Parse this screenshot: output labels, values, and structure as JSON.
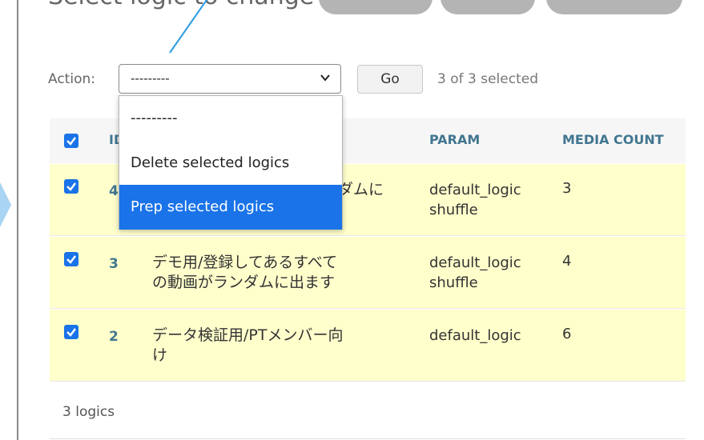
{
  "page": {
    "title": "Select logic to change"
  },
  "actions": {
    "label": "Action:",
    "selected_value": "---------",
    "go_label": "Go",
    "selection_count": "3 of 3 selected",
    "options": [
      "---------",
      "Delete selected logics",
      "Prep selected logics"
    ],
    "highlighted_option": "Prep selected logics"
  },
  "table": {
    "columns": [
      "ID",
      "PARAM",
      "MEDIA COUNT"
    ],
    "rows": [
      {
        "checked": true,
        "id": "4",
        "name_visible": "ダムに",
        "param_line1": "default_logic",
        "param_line2": "shuffle",
        "media_count": "3"
      },
      {
        "checked": true,
        "id": "3",
        "name_line1": "デモ用/登録してあるすべて",
        "name_line2": "の動画がランダムに出ます",
        "param_line1": "default_logic",
        "param_line2": "shuffle",
        "media_count": "4"
      },
      {
        "checked": true,
        "id": "2",
        "name_line1": "データ検証用/PTメンバー向",
        "name_line2": "け",
        "param_line1": "default_logic",
        "param_line2": "",
        "media_count": "6"
      }
    ]
  },
  "footer": {
    "count_text": "3 logics"
  },
  "colors": {
    "accent": "#1a73e8",
    "link": "#417690",
    "selected_row": "#ffffcc",
    "annotation": "#2b9be0"
  }
}
